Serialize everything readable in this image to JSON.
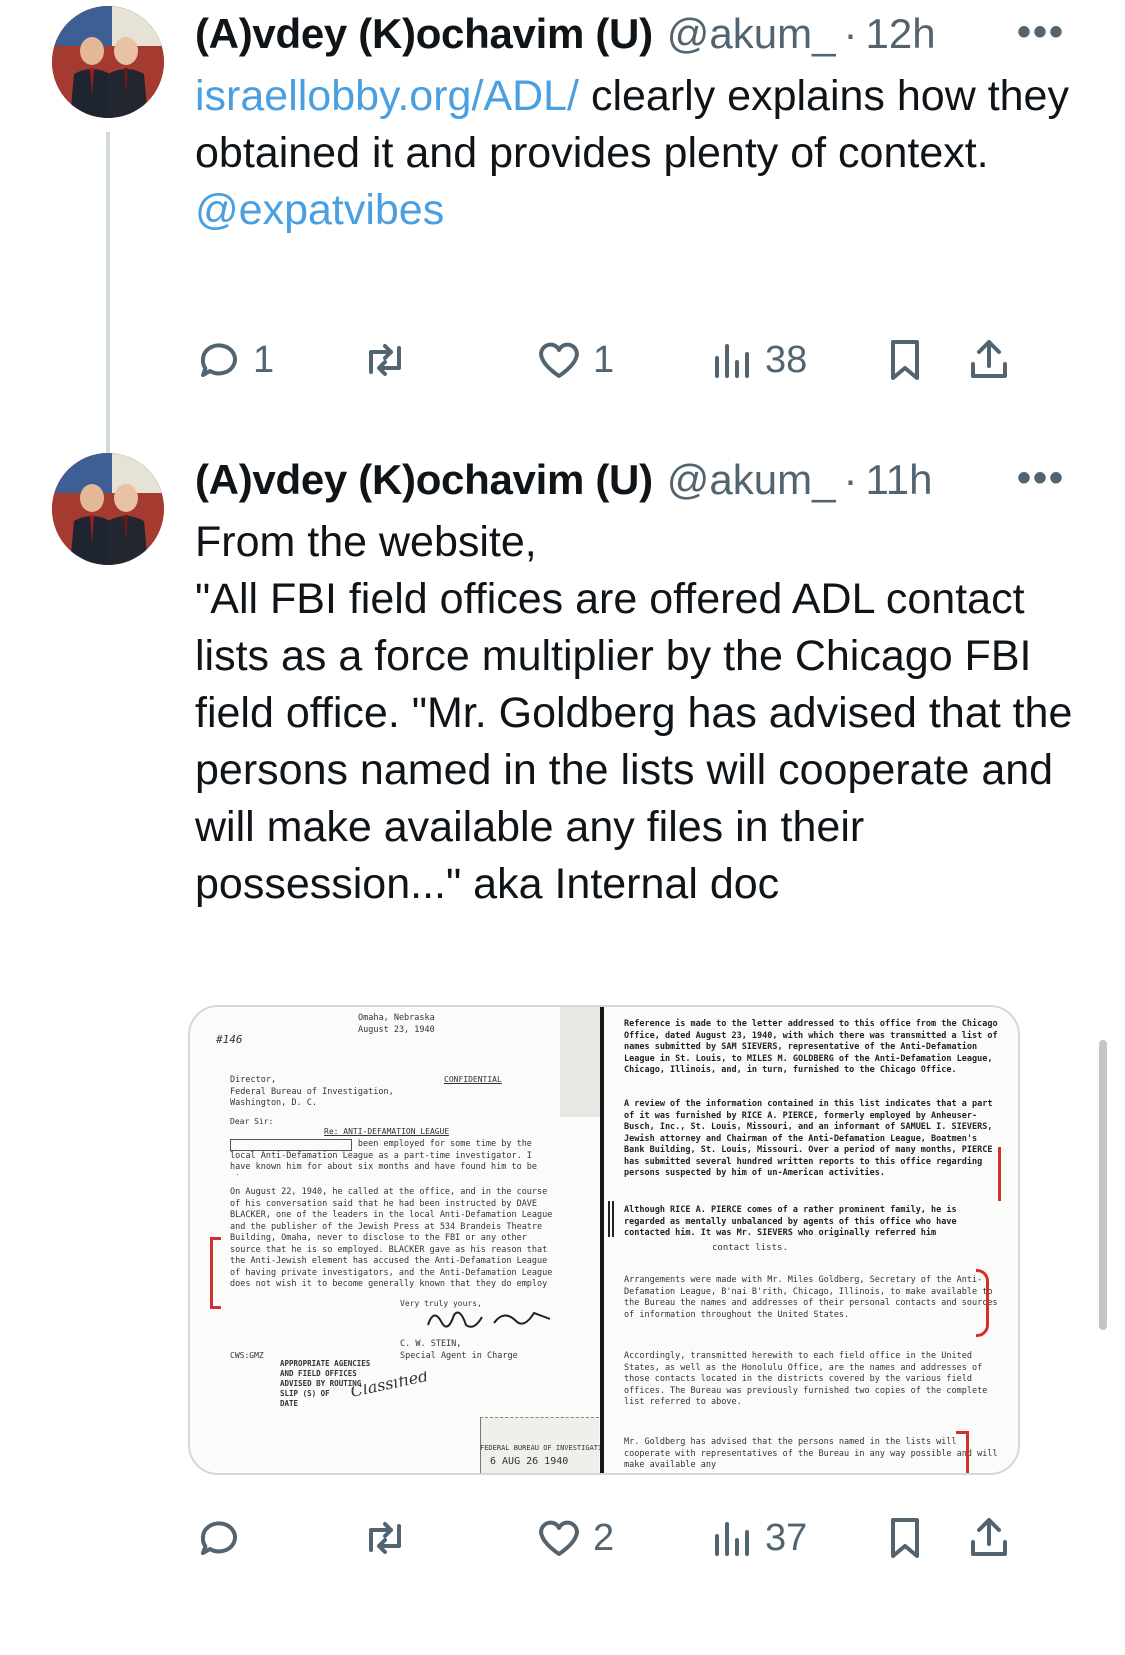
{
  "tweets": [
    {
      "author_name": "(A)vdey (K)ochavim (U)",
      "handle": "@akum_",
      "separator": "·",
      "time": "12h",
      "more_label": "•••",
      "link_text": "israellobby.org/ADL/",
      "body_after_link": " clearly explains how they obtained it and provides plenty of context.",
      "mention": "@expatvibes",
      "counts": {
        "replies": "1",
        "retweets": "",
        "likes": "1",
        "views": "38"
      }
    },
    {
      "author_name": "(A)vdey (K)ochavim (U)",
      "handle": "@akum_",
      "separator": "·",
      "time": "11h",
      "more_label": "•••",
      "body": "From the website,\n\"All FBI field offices are offered ADL contact lists as a force multiplier by the Chicago FBI field office.  \"Mr. Goldberg has advised that the persons named in the lists will cooperate and will make available any files in their possession...\" aka Internal doc",
      "counts": {
        "replies": "",
        "retweets": "",
        "likes": "2",
        "views": "37"
      }
    }
  ],
  "media": {
    "left_doc": {
      "place_date": "Omaha, Nebraska\nAugust 23, 1940",
      "file_mark": "#146",
      "address": "Director,\nFederal Bureau of Investigation,\nWashington, D. C.",
      "classification": "CONFIDENTIAL",
      "salutation": "Dear Sir:",
      "re": "Re: ANTI-DEFAMATION LEAGUE",
      "para1": "Omaha, a retired ... has been employed for some time by the local Anti-Defamation League as a part-time investigator. I have known him for about six months and have found him to be sincere.",
      "para2": "On August 22, 1940, he called at the office, and in the course of his conversation said that he had been instructed by DAVE BLACKER, one of the leaders in the local Anti-Defamation League and the publisher of the Jewish Press at 534 Brandeis Theatre Building, Omaha, never to disclose to the FBI or any other source that he is so employed. BLACKER gave as his reason that the Anti-Jewish element has accused the Anti-Defamation League of having private investigators, and the Anti-Defamation League does not wish it to become generally known that they do employ private investigators.",
      "closing": "Very truly yours,",
      "signer": "C. W. STEIN,\nSpecial Agent in Charge",
      "initials": "CWS:GMZ",
      "stamp_list": "APPROPRIATE AGENCIES\nAND FIELD OFFICES\nADVISED BY ROUTING\nSLIP (S) OF\nDATE",
      "handwriting": "Classified",
      "bureau_stamp": "FEDERAL BUREAU OF INVESTIGATION",
      "received_date": "6  AUG 26 1940"
    },
    "right_doc": {
      "para1": "Reference is made to the letter addressed to this office from the Chicago Office, dated August 23, 1940, with which there was transmitted a list of names submitted by SAM SIEVERS, representative of the Anti-Defamation League in St. Louis, to MILES M. GOLDBERG of the Anti-Defamation League, Chicago, Illinois, and, in turn, furnished to the Chicago Office.",
      "para2": "A review of the information contained in this list indicates that a part of it was furnished by RICE A. PIERCE, formerly employed by Anheuser-Busch, Inc., St. Louis, Missouri, and an informant of SAMUEL I. SIEVERS, Jewish attorney and Chairman of the Anti-Defamation League, Boatmen's Bank Building, St. Louis, Missouri. Over a period of many months, PIERCE has submitted several hundred written reports to this office regarding persons suspected by him of un-American activities.",
      "para3": "Although RICE A. PIERCE comes of a rather prominent family, he is regarded as mentally unbalanced by agents of this office who have contacted him. It was Mr. SIEVERS who originally referred him",
      "handwritten_note": "contact lists.",
      "para4": "Arrangements were made with Mr. Miles Goldberg, Secretary of the Anti-Defamation League, B'nai B'rith, Chicago, Illinois, to make available to the Bureau the names and addresses of their personal contacts and sources of information throughout the United States.",
      "para5": "Accordingly, transmitted herewith to each field office in the United States, as well as the Honolulu Office, are the names and addresses of those contacts located in the districts covered by the various field offices. The Bureau was previously furnished two copies of the complete list referred to above.",
      "para6": "Mr. Goldberg has advised that the persons named in the lists will cooperate with representatives of the Bureau in any way possible and will make available any"
    }
  },
  "colors": {
    "text": "#0f1419",
    "secondary": "#536471",
    "link": "#4a9fe0",
    "thread": "#cfd9de",
    "annotation": "#d32f2f"
  },
  "icons": [
    "reply-icon",
    "retweet-icon",
    "like-icon",
    "views-icon",
    "bookmark-icon",
    "share-icon"
  ]
}
